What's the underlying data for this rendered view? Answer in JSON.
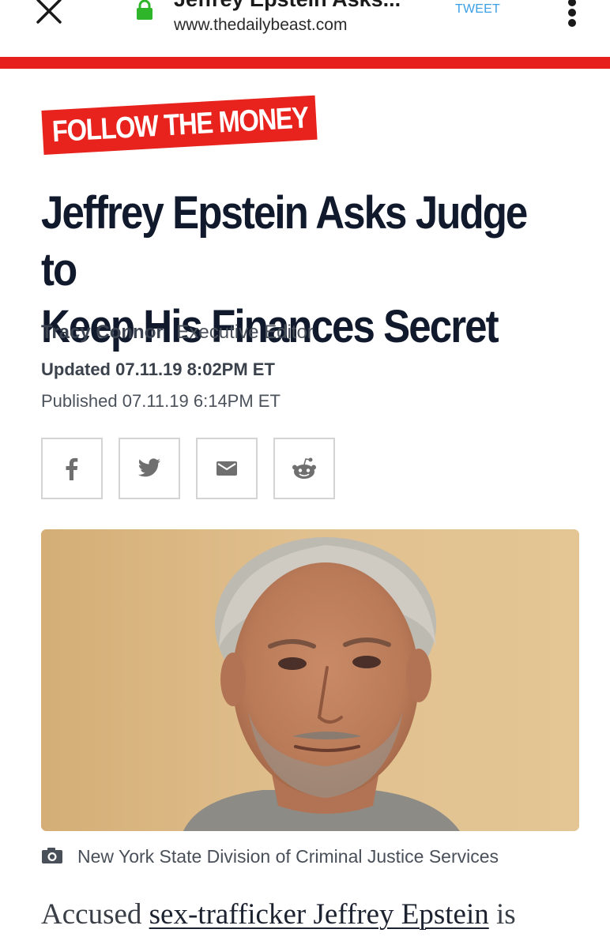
{
  "browser": {
    "page_title_truncated": "Jeffrey Epstein Asks...",
    "url": "www.thedailybeast.com",
    "tweet_label": "TWEET"
  },
  "article": {
    "section_tag": "FOLLOW THE MONEY",
    "headline_line1": "Jeffrey Epstein Asks Judge to",
    "headline_line2": "Keep His Finances Secret",
    "author": "Tracy Connor",
    "author_title": "Executive Editor",
    "updated": "Updated 07.11.19 8:02PM ET",
    "published": "Published 07.11.19 6:14PM ET",
    "share_buttons": [
      {
        "name": "facebook",
        "icon": "facebook-icon"
      },
      {
        "name": "twitter",
        "icon": "twitter-icon"
      },
      {
        "name": "email",
        "icon": "email-icon"
      },
      {
        "name": "reddit",
        "icon": "reddit-icon"
      }
    ],
    "image_caption": "New York State Division of Criminal Justice Services",
    "body_start": "Accused ",
    "body_link": "sex-trafficker Jeffrey Epstein",
    "body_after_link": " is"
  },
  "colors": {
    "brand_red": "#e6201c",
    "headline": "#111a2c",
    "tweet_blue": "#3aa0e4",
    "lock_green": "#2fb52a"
  }
}
